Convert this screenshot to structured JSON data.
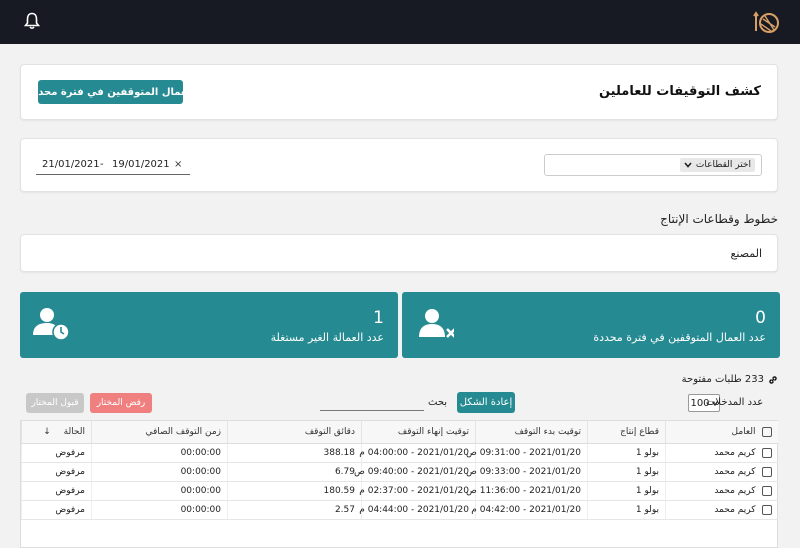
{
  "header": {
    "logo_icon": "brand-logo-icon",
    "bell_icon": "bell-icon"
  },
  "page": {
    "title": "كشف التوقيفات للعاملين",
    "period_button": "العمال المتوقفين في فترة محددة"
  },
  "filters": {
    "date_from": "19/01/2021",
    "date_separator": "-",
    "date_to": "21/01/2021",
    "clear": "×",
    "sector_select": "اختر القطاعات"
  },
  "lines": {
    "heading": "خطوط وقطاعات الإنتاج",
    "factory": "المصنع"
  },
  "stats": [
    {
      "value": "0",
      "label": "عدد العمال المتوقفين في فترة محددة",
      "icon": "user-remove-icon"
    },
    {
      "value": "1",
      "label": "عدد العمالة الغير مستغلة",
      "icon": "user-clock-icon"
    }
  ],
  "requests": {
    "count_text": "233 طلبات مفتوحة",
    "icon": "link-icon"
  },
  "toolbar": {
    "entries_label": "عدد المدخلات",
    "entries_value": "100",
    "reset_button": "إعادة الشكل",
    "search_label": "بحث",
    "search_placeholder": "",
    "reject_button": "رفض المختار",
    "accept_button": "قبول المختار"
  },
  "table": {
    "columns": [
      "العامل",
      "قطاع إنتاج",
      "توقيت بدء التوقف",
      "توقيت إنهاء التوقف",
      "دقائق التوقف",
      "زمن التوقف الصافي",
      "الحالة"
    ],
    "sort_indicator": "↓",
    "rows": [
      [
        "كريم محمد",
        "بولو 1",
        "2021/01/20 - 09:31:00 ص",
        "2021/01/20 - 04:00:00 م",
        "388.18",
        "00:00:00",
        "مرفوض"
      ],
      [
        "كريم محمد",
        "بولو 1",
        "2021/01/20 - 09:33:00 ص",
        "2021/01/20 - 09:40:00 ص",
        "6.79",
        "00:00:00",
        "مرفوض"
      ],
      [
        "كريم محمد",
        "بولو 1",
        "2021/01/20 - 11:36:00 ص",
        "2021/01/20 - 02:37:00 م",
        "180.59",
        "00:00:00",
        "مرفوض"
      ],
      [
        "كريم محمد",
        "بولو 1",
        "2021/01/20 - 04:42:00 م",
        "2021/01/20 - 04:44:00 م",
        "2.57",
        "00:00:00",
        "مرفوض"
      ]
    ]
  },
  "colors": {
    "topbar": "#181a23",
    "accent": "#258a91",
    "reject": "#f08080",
    "disabled": "#c8c8c8"
  }
}
